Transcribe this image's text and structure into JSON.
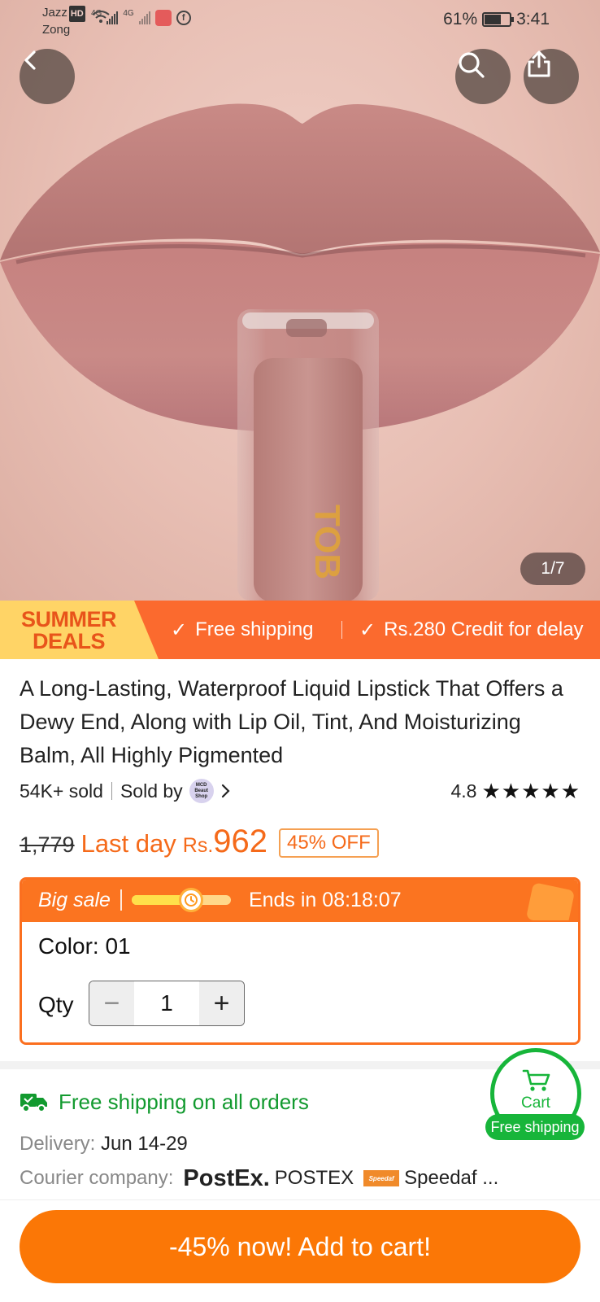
{
  "status_bar": {
    "carrier1": "Jazz",
    "carrier1_badge": "HD",
    "carrier2": "Zong",
    "network1": "4G",
    "network2": "4G",
    "battery_text": "61%",
    "battery_level": 0.61,
    "time": "3:41"
  },
  "gallery": {
    "counter": "1/7",
    "product_print": "TOB"
  },
  "deals_strip": {
    "badge_line1": "SUMMER",
    "badge_line2": "DEALS",
    "item1": "Free shipping",
    "item2": "Rs.280 Credit for delay",
    "check": "✓"
  },
  "product": {
    "title": "A Long-Lasting, Waterproof Liquid Lipstick That Offers a Dewy End, Along with Lip Oil, Tint, And Moisturizing Balm, All Highly Pigmented",
    "sold": "54K+ sold",
    "sold_by": "Sold by",
    "shop_logo_text": "MCD Beaut Shop",
    "rating": "4.8",
    "stars": "★★★★★",
    "old_price": "1,779",
    "last_day": "Last day",
    "currency": "Rs.",
    "price": "962",
    "discount": "45% OFF"
  },
  "sale": {
    "label": "Big sale",
    "progress": 0.6,
    "ends_in": "Ends in 08:18:07",
    "color": "Color: 01",
    "qty_label": "Qty",
    "minus": "−",
    "qty": "1",
    "plus": "+"
  },
  "shipping": {
    "free_shipping": "Free shipping on all orders",
    "delivery_label": "Delivery:",
    "delivery_value": "Jun 14-29",
    "courier_label": "Courier company:",
    "courier1_logo": "PostEx.",
    "courier1": "POSTEX",
    "courier2_logo": "Speedaf",
    "courier2": "Speedaf ..."
  },
  "cart_fab": {
    "label": "Cart",
    "pill": "Free shipping"
  },
  "bottom": {
    "add_to_cart": "-45% now! Add to cart!"
  },
  "colors": {
    "accent_orange": "#fb7706",
    "strip_orange": "#fb6a2e",
    "price_orange": "#f56a1a",
    "green": "#17b53a"
  },
  "icons": {
    "back": "chevron-left-icon",
    "search": "search-icon",
    "share": "share-icon",
    "truck": "truck-icon",
    "cart": "cart-icon",
    "clock": "clock-icon"
  }
}
